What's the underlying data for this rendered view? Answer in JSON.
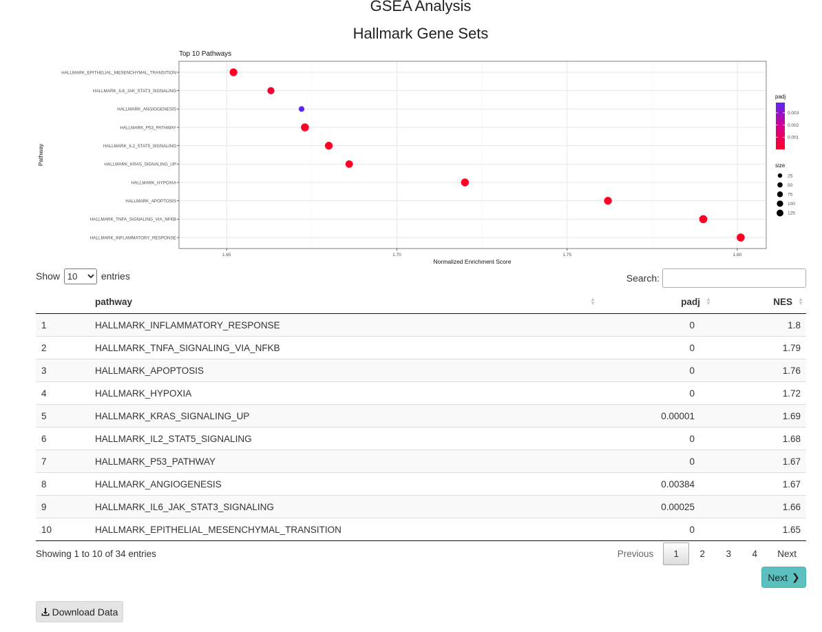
{
  "page": {
    "title": "GSEA Analysis",
    "subtitle": "Hallmark Gene Sets"
  },
  "chart_data": {
    "type": "scatter",
    "title": "Top 10 Pathways",
    "xlabel": "Normalized Enrichment Score",
    "ylabel": "Pathway",
    "xlim": [
      1.636,
      1.8085
    ],
    "x_ticks": [
      1.65,
      1.7,
      1.75,
      1.8
    ],
    "x_tick_labels": [
      "1.65",
      "1.70",
      "1.75",
      "1.80"
    ],
    "grid": true,
    "legend_position": "right",
    "points": [
      {
        "pathway": "HALLMARK_EPITHELIAL_MESENCHYMAL_TRANSITION",
        "label": "HALLMARK_EPITHELIAL_MESENCHYMAL_TRANSITION",
        "nes": 1.652,
        "padj": 0,
        "size": 110
      },
      {
        "pathway": "HALLMARK_IL6_JAK_STAT3_SIGNALING",
        "label": "HALLMARK_IL6_JAK_STAT3_SIGNALING",
        "nes": 1.663,
        "padj": 0.00025,
        "size": 85
      },
      {
        "pathway": "HALLMARK_ANGIOGENESIS",
        "label": "HALLMARK_ANGIOGENESIS",
        "nes": 1.672,
        "padj": 0.00384,
        "size": 36
      },
      {
        "pathway": "HALLMARK_P53_PATHWAY",
        "label": "HALLMARK_P53_PATHWAY",
        "nes": 1.673,
        "padj": 0,
        "size": 125
      },
      {
        "pathway": "HALLMARK_IL2_STAT5_SIGNALING",
        "label": "HALLMARK_IL2_STAT5_SIGNALING",
        "nes": 1.68,
        "padj": 0,
        "size": 112
      },
      {
        "pathway": "HALLMARK_KRAS_SIGNALING_UP",
        "label": "HALLMARK_KRAS_SIGNALING_UP",
        "nes": 1.686,
        "padj": 1e-05,
        "size": 100
      },
      {
        "pathway": "HALLMARK_HYPOXIA",
        "label": "HALLMARK_HYPOXIA",
        "nes": 1.72,
        "padj": 0,
        "size": 120
      },
      {
        "pathway": "HALLMARK_APOPTOSIS",
        "label": "HALLMARK_APOPTOSIS",
        "nes": 1.762,
        "padj": 0,
        "size": 115
      },
      {
        "pathway": "HALLMARK_TNFA_SIGNALING_VIA_NFKB",
        "label": "HALLMARK_TNFA_SIGNALING_VIA_NFKB",
        "nes": 1.79,
        "padj": 0,
        "size": 128
      },
      {
        "pathway": "HALLMARK_INFLAMMATORY_RESPONSE",
        "label": "HALLMARK_INFLAMMATORY_RESPONSE",
        "nes": 1.801,
        "padj": 0,
        "size": 128
      }
    ],
    "legend_padj": {
      "title": "padj",
      "breaks": [
        0.003,
        0.002,
        0.001
      ],
      "break_labels": [
        "0.003",
        "0.002",
        "0.001"
      ],
      "range": [
        0,
        0.00384
      ],
      "low_color": "#ff0026",
      "high_color": "#5b26f5"
    },
    "legend_size": {
      "title": "size",
      "breaks": [
        25,
        50,
        75,
        100,
        125
      ],
      "break_labels": [
        "25",
        "50",
        "75",
        "100",
        "125"
      ]
    }
  },
  "table": {
    "length_label_pre": "Show",
    "length_label_post": "entries",
    "length_selected": "10",
    "search_label": "Search:",
    "search_value": "",
    "headers": {
      "index": "",
      "pathway": "pathway",
      "padj": "padj",
      "nes": "NES"
    },
    "rows": [
      {
        "idx": "1",
        "pathway": "HALLMARK_INFLAMMATORY_RESPONSE",
        "padj": "0",
        "nes": "1.8"
      },
      {
        "idx": "2",
        "pathway": "HALLMARK_TNFA_SIGNALING_VIA_NFKB",
        "padj": "0",
        "nes": "1.79"
      },
      {
        "idx": "3",
        "pathway": "HALLMARK_APOPTOSIS",
        "padj": "0",
        "nes": "1.76"
      },
      {
        "idx": "4",
        "pathway": "HALLMARK_HYPOXIA",
        "padj": "0",
        "nes": "1.72"
      },
      {
        "idx": "5",
        "pathway": "HALLMARK_KRAS_SIGNALING_UP",
        "padj": "0.00001",
        "nes": "1.69"
      },
      {
        "idx": "6",
        "pathway": "HALLMARK_IL2_STAT5_SIGNALING",
        "padj": "0",
        "nes": "1.68"
      },
      {
        "idx": "7",
        "pathway": "HALLMARK_P53_PATHWAY",
        "padj": "0",
        "nes": "1.67"
      },
      {
        "idx": "8",
        "pathway": "HALLMARK_ANGIOGENESIS",
        "padj": "0.00384",
        "nes": "1.67"
      },
      {
        "idx": "9",
        "pathway": "HALLMARK_IL6_JAK_STAT3_SIGNALING",
        "padj": "0.00025",
        "nes": "1.66"
      },
      {
        "idx": "10",
        "pathway": "HALLMARK_EPITHELIAL_MESENCHYMAL_TRANSITION",
        "padj": "0",
        "nes": "1.65"
      }
    ],
    "info": "Showing 1 to 10 of 34 entries",
    "pagination": {
      "previous": "Previous",
      "pages": [
        "1",
        "2",
        "3",
        "4"
      ],
      "current": "1",
      "next": "Next"
    }
  },
  "buttons": {
    "next": "Next",
    "download": "Download Data"
  },
  "colors": {
    "next_button": "#5bc0be",
    "download_button": "#e4e4e4"
  }
}
